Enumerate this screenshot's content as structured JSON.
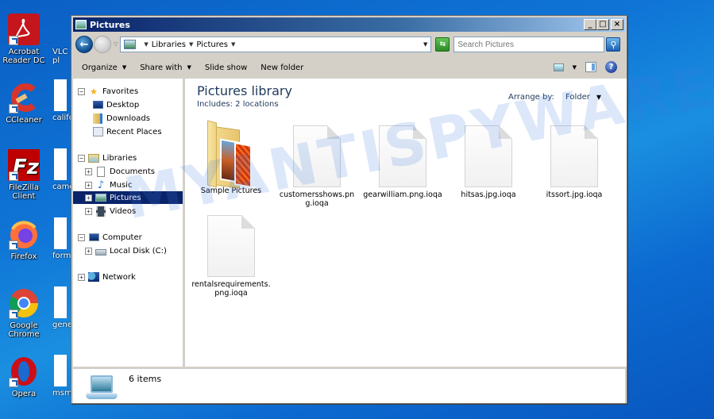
{
  "desktop": {
    "icons": [
      {
        "label": "Acrobat Reader DC",
        "icon": "acrobat-icon",
        "color": "#c4161c"
      },
      {
        "label": "CCleaner",
        "icon": "ccleaner-icon",
        "color": "#d9342a"
      },
      {
        "label": "FileZilla Client",
        "icon": "filezilla-icon",
        "color": "#bf0000"
      },
      {
        "label": "Firefox",
        "icon": "firefox-icon",
        "color": "#ff7139"
      },
      {
        "label": "Google Chrome",
        "icon": "chrome-icon",
        "color": "#4285f4"
      },
      {
        "label": "Opera",
        "icon": "opera-icon",
        "color": "#cc0f16"
      }
    ],
    "partial_icons": [
      {
        "label": "VLC pl"
      },
      {
        "label": "califo"
      },
      {
        "label": "came"
      },
      {
        "label": "forme"
      },
      {
        "label": "gene"
      },
      {
        "label": "msmil"
      }
    ]
  },
  "window": {
    "title": "Pictures",
    "controls": {
      "minimize": "_",
      "maximize": "□",
      "close": "×"
    },
    "address": {
      "crumbs": [
        "Libraries",
        "Pictures"
      ]
    },
    "search": {
      "placeholder": "Search Pictures"
    },
    "toolbar": {
      "organize": "Organize",
      "share_with": "Share with",
      "slide_show": "Slide show",
      "new_folder": "New folder"
    },
    "nav_pane": {
      "favorites": {
        "label": "Favorites",
        "items": [
          "Desktop",
          "Downloads",
          "Recent Places"
        ]
      },
      "libraries": {
        "label": "Libraries",
        "items": [
          "Documents",
          "Music",
          "Pictures",
          "Videos"
        ],
        "selected": "Pictures"
      },
      "computer": {
        "label": "Computer",
        "items": [
          "Local Disk (C:)"
        ]
      },
      "network": {
        "label": "Network"
      }
    },
    "content": {
      "title": "Pictures library",
      "subtitle": "Includes:  2 locations",
      "arrange_label": "Arrange by:",
      "arrange_value": "Folder",
      "files": [
        {
          "name": "Sample Pictures",
          "type": "folder"
        },
        {
          "name": "customersshows.png.ioqa",
          "type": "file"
        },
        {
          "name": "gearwilliam.png.ioqa",
          "type": "file"
        },
        {
          "name": "hitsas.jpg.ioqa",
          "type": "file"
        },
        {
          "name": "itssort.jpg.ioqa",
          "type": "file"
        },
        {
          "name": "rentalsrequirements.png.ioqa",
          "type": "file"
        }
      ]
    },
    "status": {
      "text": "6 items"
    }
  },
  "watermark": "MYANTISPYWARE.COM"
}
